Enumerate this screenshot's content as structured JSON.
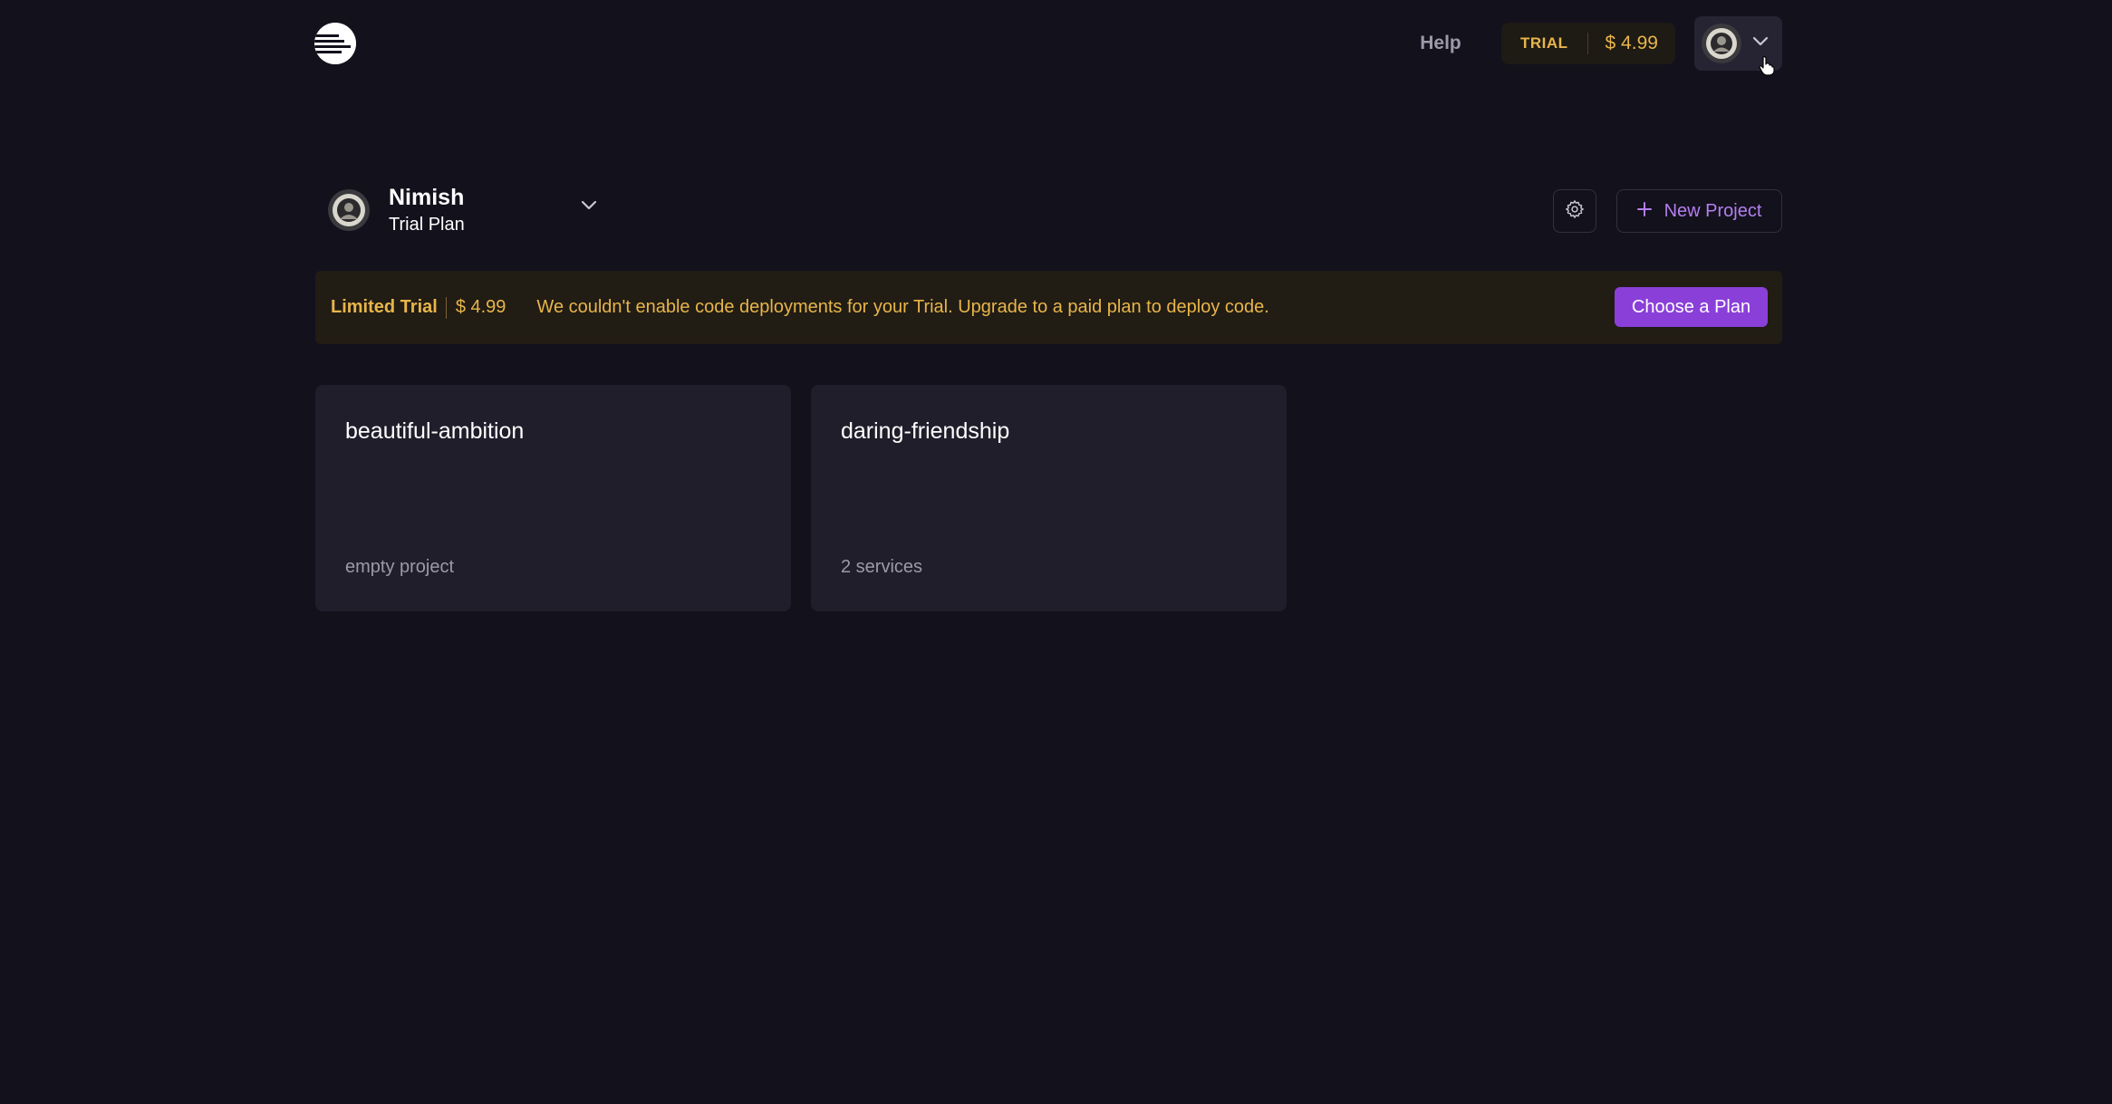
{
  "header": {
    "help_label": "Help",
    "trial_label": "TRIAL",
    "trial_amount": "$ 4.99"
  },
  "team": {
    "name": "Nimish",
    "plan": "Trial Plan"
  },
  "toolbar": {
    "new_project_label": "New Project"
  },
  "banner": {
    "title": "Limited Trial",
    "amount": "$ 4.99",
    "message": "We couldn't enable code deployments for your Trial. Upgrade to a paid plan to deploy code.",
    "cta_label": "Choose a Plan"
  },
  "projects": [
    {
      "name": "beautiful-ambition",
      "subtitle": "empty project"
    },
    {
      "name": "daring-friendship",
      "subtitle": "2 services"
    }
  ],
  "icons": {
    "logo": "railway-logo-icon",
    "avatar": "user-avatar",
    "chevron": "chevron-down-icon",
    "settings": "gear-icon",
    "plus": "plus-icon",
    "cursor": "hand-pointer-cursor"
  },
  "colors": {
    "background": "#13111c",
    "card": "#201e2b",
    "accent_purple": "#8a3fd9",
    "accent_purple_text": "#b37ff0",
    "trial_gold": "#e8b54a",
    "banner_bg": "#211c14",
    "muted_text": "#9c9aa8"
  }
}
